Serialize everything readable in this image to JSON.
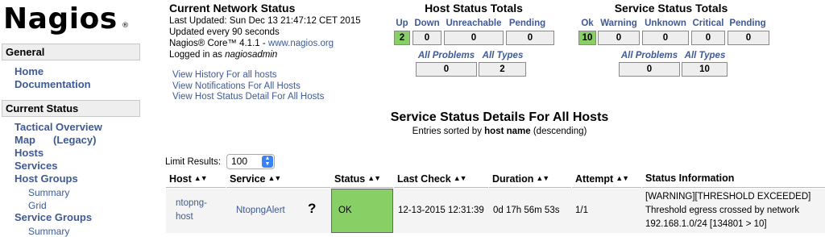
{
  "logo": {
    "text": "Nagios",
    "reg": "®"
  },
  "sidebar": {
    "general_header": "General",
    "general_links": [
      {
        "label": "Home"
      },
      {
        "label": "Documentation"
      }
    ],
    "current_header": "Current Status",
    "tactical": "Tactical Overview",
    "map": "Map",
    "legacy": "(Legacy)",
    "hosts": "Hosts",
    "services": "Services",
    "host_groups": "Host Groups",
    "hg_summary": "Summary",
    "hg_grid": "Grid",
    "service_groups": "Service Groups",
    "sg_summary": "Summary"
  },
  "network_status": {
    "title": "Current Network Status",
    "last_updated": "Last Updated: Sun Dec 13 21:47:12 CET 2015",
    "update_interval": "Updated every 90 seconds",
    "version_prefix": "Nagios® Core™ 4.1.1 - ",
    "version_link": "www.nagios.org",
    "logged_prefix": "Logged in as ",
    "user": "nagiosadmin",
    "links": [
      "View History For all hosts",
      "View Notifications For All Hosts",
      "View Host Status Detail For All Hosts"
    ]
  },
  "host_totals": {
    "title": "Host Status Totals",
    "headers": [
      "Up",
      "Down",
      "Unreachable",
      "Pending"
    ],
    "values": [
      "2",
      "0",
      "0",
      "0"
    ],
    "all_problems_label": "All Problems",
    "all_types_label": "All Types",
    "all_problems": "0",
    "all_types": "2"
  },
  "service_totals": {
    "title": "Service Status Totals",
    "headers": [
      "Ok",
      "Warning",
      "Unknown",
      "Critical",
      "Pending"
    ],
    "values": [
      "10",
      "0",
      "0",
      "0",
      "0"
    ],
    "all_problems_label": "All Problems",
    "all_types_label": "All Types",
    "all_problems": "0",
    "all_types": "10"
  },
  "main": {
    "title": "Service Status Details For All Hosts",
    "sort_prefix": "Entries sorted by ",
    "sort_field": "host name",
    "sort_suffix": " (descending)",
    "limit_label": "Limit Results:",
    "limit_value": "100"
  },
  "table": {
    "headers": [
      "Host",
      "Service",
      "Status",
      "Last Check",
      "Duration",
      "Attempt",
      "Status Information"
    ],
    "rows": [
      {
        "host": "ntopng-host",
        "host_line1": "ntopng-",
        "host_line2": "host",
        "service": "NtopngAlert",
        "unknown_icon": "?",
        "status": "OK",
        "last_check": "12-13-2015 12:31:39",
        "duration": "0d 17h 56m 53s",
        "attempt": "1/1",
        "info_line1": "[WARNING][THRESHOLD EXCEEDED]",
        "info_line2": "Threshold egress crossed by network",
        "info_line3": "192.168.1.0/24 [134801 > 10]"
      }
    ]
  },
  "colors": {
    "link": "#3e5a95",
    "ok_green": "#88d066",
    "box_gray": "#eeeeee"
  }
}
